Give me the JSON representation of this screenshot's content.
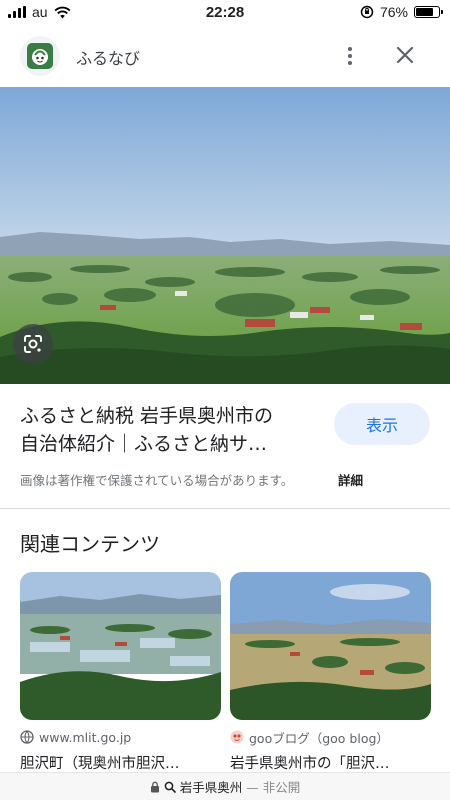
{
  "status_bar": {
    "carrier": "au",
    "time": "22:28",
    "battery_percent": "76%",
    "battery_level": 0.76
  },
  "header": {
    "title": "ふるなび"
  },
  "hero": {
    "lens_icon": "google-lens-icon"
  },
  "result": {
    "title_line1": "ふるさと納税 岩手県奥州市の",
    "title_line2": "自治体紹介｜ふるさと納サ…",
    "show_button": "表示",
    "notice": "画像は著作権で保護されている場合があります。",
    "details_link": "詳細"
  },
  "related": {
    "heading": "関連コンテンツ",
    "items": [
      {
        "source": "www.mlit.go.jp",
        "title": "胆沢町（現奥州市胆沢…"
      },
      {
        "source": "gooブログ（goo blog）",
        "title": "岩手県奥州市の「胆沢…"
      }
    ]
  },
  "url_bar": {
    "query": "岩手県奥州",
    "status": "— 非公開"
  },
  "colors": {
    "accent": "#1a73e8",
    "button_bg": "#e8f0fe",
    "sky": "#a9c6e6",
    "field": "#7fb55a"
  }
}
